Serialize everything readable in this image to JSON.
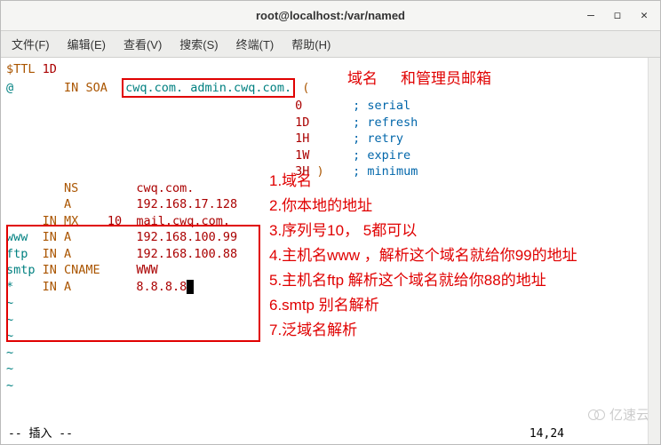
{
  "window": {
    "title": "root@localhost:/var/named",
    "buttons": {
      "min": "—",
      "max": "◻",
      "close": "✕"
    }
  },
  "menu": {
    "file": "文件(F)",
    "edit": "编辑(E)",
    "view": "查看(V)",
    "search": "搜索(S)",
    "terminal": "终端(T)",
    "help": "帮助(H)"
  },
  "zone": {
    "ttl_directive": "$TTL",
    "ttl_value": "1D",
    "origin": "@",
    "in": "IN",
    "soa": "SOA",
    "primary": "cwq.com.",
    "admin": "admin.cwq.com.",
    "open": "(",
    "serial_val": "0",
    "serial_lbl": "; serial",
    "refresh_val": "1D",
    "refresh_lbl": "; refresh",
    "retry_val": "1H",
    "retry_lbl": "; retry",
    "expire_val": "1W",
    "expire_lbl": "; expire",
    "min_val": "3H",
    "close": ")",
    "min_lbl": "; minimum",
    "records": [
      {
        "host": "",
        "in": "",
        "type": "NS",
        "pri": "",
        "val": "cwq.com."
      },
      {
        "host": "",
        "in": "",
        "type": "A",
        "pri": "",
        "val": "192.168.17.128"
      },
      {
        "host": "",
        "in": "IN",
        "type": "MX",
        "pri": "10",
        "val": "mail.cwq.com."
      },
      {
        "host": "www",
        "in": "IN",
        "type": "A",
        "pri": "",
        "val": "192.168.100.99"
      },
      {
        "host": "ftp",
        "in": "IN",
        "type": "A",
        "pri": "",
        "val": "192.168.100.88"
      },
      {
        "host": "smtp",
        "in": "IN",
        "type": "CNAME",
        "pri": "",
        "val": "WWW"
      },
      {
        "host": "*",
        "in": "IN",
        "type": "A",
        "pri": "",
        "val": "8.8.8.8"
      }
    ]
  },
  "annotations": {
    "top1": "域名",
    "top2": "和管理员邮箱",
    "n1": "1.域名",
    "n2": "2.你本地的地址",
    "n3": "3.序列号10， 5都可以",
    "n4": "4.主机名www ，解析这个域名就给你99的地址",
    "n5": "5.主机名ftp     解析这个域名就给你88的地址",
    "n6": "6.smtp  别名解析",
    "n7": "7.泛域名解析"
  },
  "status": {
    "mode": "-- 插入 --",
    "pos": "14,24"
  },
  "watermark": "亿速云",
  "tilde": "~"
}
